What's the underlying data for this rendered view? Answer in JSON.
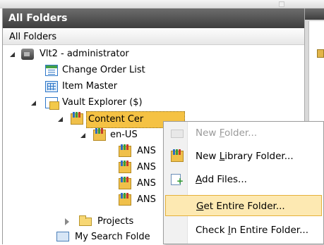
{
  "panel": {
    "title": "All Folders",
    "column_header": "All Folders"
  },
  "tree": {
    "root": {
      "label": "Vlt2 - administrator",
      "icon": "server-icon"
    },
    "change_order_list": {
      "label": "Change Order List",
      "icon": "list-icon"
    },
    "item_master": {
      "label": "Item Master",
      "icon": "grid-icon"
    },
    "vault_explorer": {
      "label": "Vault Explorer ($)",
      "icon": "vault-icon"
    },
    "content_center": {
      "label": "Content Cer",
      "icon": "library-folder-icon",
      "selected": true
    },
    "en_us": {
      "label": "en-US",
      "icon": "library-folder-icon"
    },
    "ansi_items": [
      {
        "label": "ANS"
      },
      {
        "label": "ANS"
      },
      {
        "label": "ANS"
      },
      {
        "label": "ANS"
      }
    ],
    "projects": {
      "label": "Projects",
      "icon": "folder-icon"
    },
    "my_search_folders": {
      "label": "My Search Folde",
      "icon": "search-folder-icon"
    }
  },
  "context_menu": {
    "items": [
      {
        "pre": "New ",
        "key": "F",
        "post": "older...",
        "enabled": false
      },
      {
        "pre": "New ",
        "key": "L",
        "post": "ibrary Folder...",
        "enabled": true
      },
      {
        "pre": "",
        "key": "A",
        "post": "dd Files...",
        "enabled": true
      },
      {
        "pre": "",
        "key": "G",
        "post": "et Entire Folder...",
        "enabled": true,
        "highlighted": true
      },
      {
        "pre": "Check ",
        "key": "I",
        "post": "n Entire Folder...",
        "enabled": true
      }
    ]
  },
  "colors": {
    "selection": "#f5c244",
    "menu_highlight": "#fde9b2",
    "header_dark": "#4a4a4a"
  }
}
